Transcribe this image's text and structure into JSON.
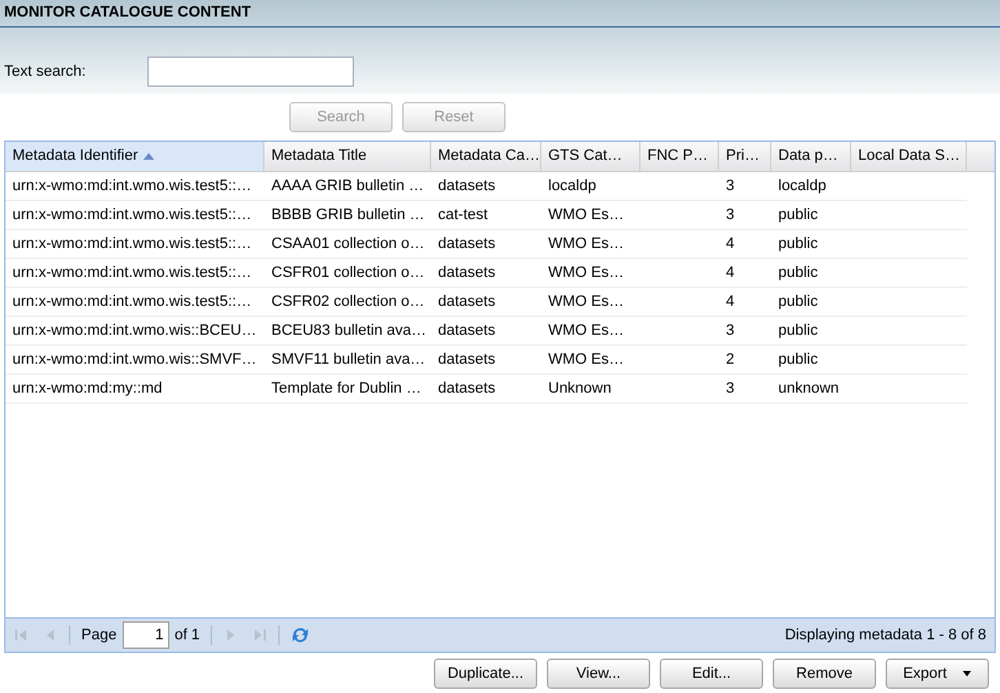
{
  "panel": {
    "title": "MONITOR CATALOGUE CONTENT"
  },
  "search": {
    "label": "Text search:"
  },
  "search_buttons": [
    {
      "label": "Search",
      "disabled": true
    },
    {
      "label": "Reset",
      "disabled": true
    }
  ],
  "table": {
    "columns": [
      {
        "label": "Metadata Identifier",
        "sorted": true
      },
      {
        "label": "Metadata Title",
        "sorted": false
      },
      {
        "label": "Metadata Ca…",
        "sorted": false
      },
      {
        "label": "GTS Cat…",
        "sorted": false
      },
      {
        "label": "FNC P…",
        "sorted": false
      },
      {
        "label": "Pri…",
        "sorted": false
      },
      {
        "label": "Data p…",
        "sorted": false
      },
      {
        "label": "Local Data S…",
        "sorted": false
      }
    ],
    "rows": [
      [
        "urn:x-wmo:md:int.wmo.wis.test5::…",
        "AAAA GRIB bulletin …",
        "datasets",
        "localdp",
        "",
        "3",
        "localdp",
        ""
      ],
      [
        "urn:x-wmo:md:int.wmo.wis.test5::…",
        "BBBB GRIB bulletin …",
        "cat-test",
        "WMO Es…",
        "",
        "3",
        "public",
        ""
      ],
      [
        "urn:x-wmo:md:int.wmo.wis.test5::…",
        "CSAA01 collection o…",
        "datasets",
        "WMO Es…",
        "",
        "4",
        "public",
        ""
      ],
      [
        "urn:x-wmo:md:int.wmo.wis.test5::…",
        "CSFR01 collection o…",
        "datasets",
        "WMO Es…",
        "",
        "4",
        "public",
        ""
      ],
      [
        "urn:x-wmo:md:int.wmo.wis.test5::…",
        "CSFR02 collection o…",
        "datasets",
        "WMO Es…",
        "",
        "4",
        "public",
        ""
      ],
      [
        "urn:x-wmo:md:int.wmo.wis::BCEU…",
        "BCEU83 bulletin ava…",
        "datasets",
        "WMO Es…",
        "",
        "3",
        "public",
        ""
      ],
      [
        "urn:x-wmo:md:int.wmo.wis::SMVF…",
        "SMVF11 bulletin ava…",
        "datasets",
        "WMO Es…",
        "",
        "2",
        "public",
        ""
      ],
      [
        "urn:x-wmo:md:my::md",
        "Template for Dublin …",
        "datasets",
        "Unknown",
        "",
        "3",
        "unknown",
        ""
      ]
    ]
  },
  "paging": {
    "page_label": "Page",
    "page": "1",
    "of_label": "of 1",
    "first_disabled": true,
    "prev_disabled": true,
    "next_disabled": true,
    "last_disabled": true,
    "summary": "Displaying metadata 1 - 8 of 8"
  },
  "actions": [
    {
      "label": "Duplicate...",
      "kind": "plain"
    },
    {
      "label": "View...",
      "kind": "plain"
    },
    {
      "label": "Edit...",
      "kind": "plain"
    },
    {
      "label": "Remove",
      "kind": "plain"
    },
    {
      "label": "Export",
      "kind": "menu"
    }
  ]
}
